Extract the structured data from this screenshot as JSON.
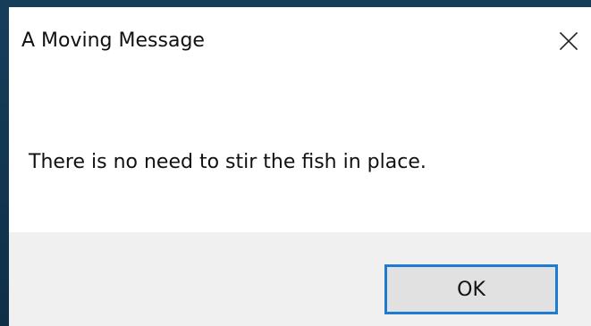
{
  "dialog": {
    "title": "A Moving Message",
    "message": "There is no need to stir the fish in place.",
    "ok_label": "OK",
    "close_icon": "close-icon"
  },
  "colors": {
    "desktop_background": "#123651",
    "dialog_background": "#ffffff",
    "footer_background": "#f0f0f0",
    "button_background": "#e1e1e1",
    "button_border": "#1f7bd0",
    "text": "#111111"
  }
}
